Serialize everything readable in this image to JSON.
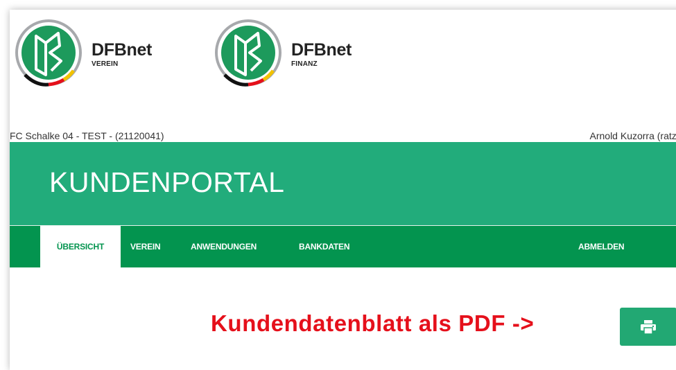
{
  "logos": [
    {
      "brand": "DFBnet",
      "sub": "VEREIN"
    },
    {
      "brand": "DFBnet",
      "sub": "FINANZ"
    }
  ],
  "header": {
    "club": "FC Schalke 04 - TEST - (21120041)",
    "user": "Arnold Kuzorra (ratzelm)"
  },
  "portal": {
    "title": "KUNDENPORTAL"
  },
  "nav": {
    "items": [
      {
        "label": "ÜBERSICHT",
        "active": true
      },
      {
        "label": "VEREIN",
        "active": false
      },
      {
        "label": "ANWENDUNGEN",
        "active": false
      },
      {
        "label": "BANKDATEN",
        "active": false
      }
    ],
    "logout": "ABMELDEN"
  },
  "pdf": {
    "label": "Kundendatenblatt als PDF ->",
    "button_icon": "printer-icon"
  },
  "colors": {
    "portal_green": "#22ac7b",
    "nav_green": "#03944f",
    "button_green": "#22a873",
    "pdf_red": "#e5101b"
  }
}
